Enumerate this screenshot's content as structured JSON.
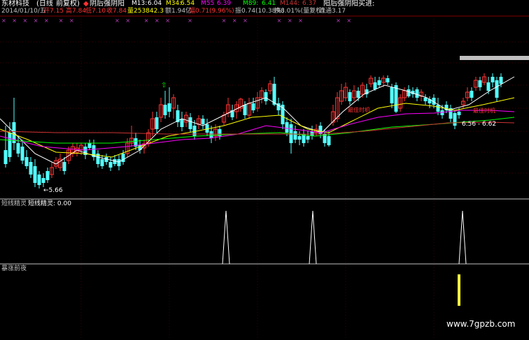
{
  "header": {
    "title": "东材科技",
    "period": "(日线",
    "adjust": "前复权)",
    "indicator": "阴后强阴阳",
    "m13_label": "M13:",
    "m13_value": "6.04",
    "m34_label": "M34:",
    "m34_value": "6.54",
    "m55_label": "M55",
    "m55_value": "6.39",
    "m89_label": "M89:",
    "m89_value": "6.41",
    "m144_label": "M144:",
    "m144_value": "6.37",
    "right_label": "阳后强阴阳买进:"
  },
  "info": {
    "date": "2014/01/10/五",
    "open": "开7.15",
    "high": "高7.84",
    "low": "低7.10",
    "close": "收7.84",
    "volume": "量253842.3",
    "amount": "额1.94亿",
    "change": "幅0.71(9.96%)",
    "swing": "振0.74(10.38%)",
    "turnover": "换8.01%(量复权)",
    "float": "流通3.17"
  },
  "annotations": {
    "low_price": "←5.66",
    "range": "6.56 - 6.62",
    "best_time_1": "最佳时机",
    "best_time_2": "最佳时机"
  },
  "panels": {
    "panel2_title": "短线精灵",
    "panel2_value": "短线精灵: 0.00",
    "panel3_title": "暴涨前夜"
  },
  "watermark": "www.7gpzb.com",
  "colors": {
    "up": "#ff3232",
    "down": "#54ffff",
    "ma13": "#ffffff",
    "ma34": "#ffff00",
    "ma55": "#ff00ff",
    "ma89": "#00ff00",
    "ma144": "#cc3333",
    "signal": "#ffff40"
  }
}
